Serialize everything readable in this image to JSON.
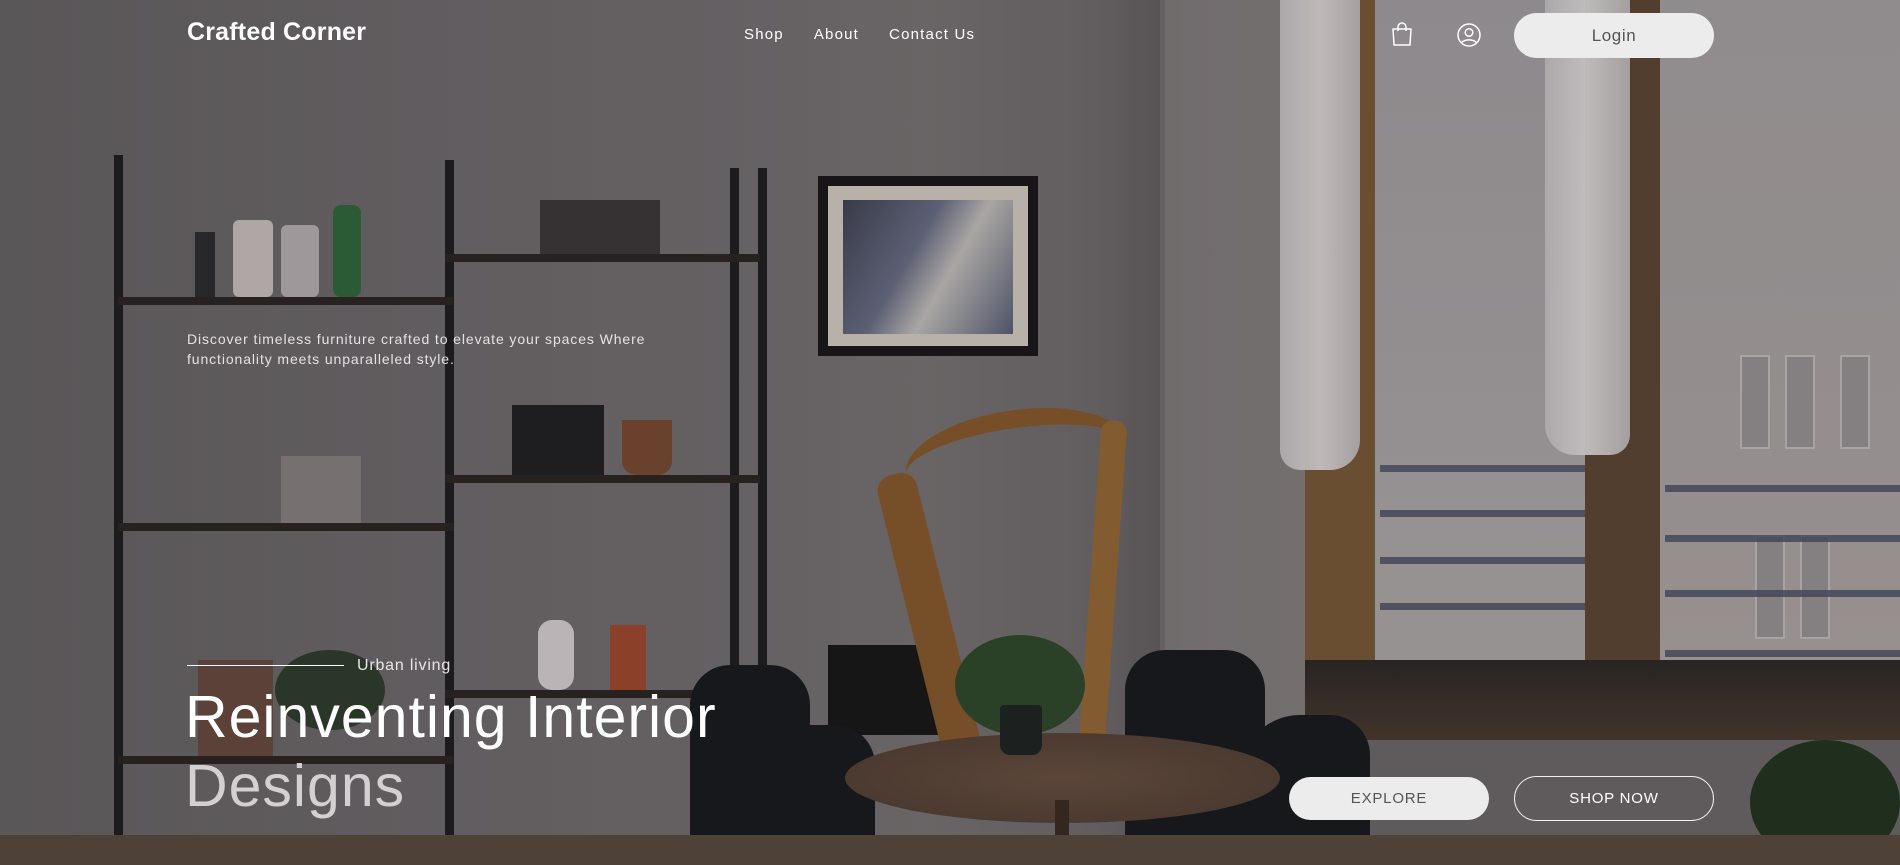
{
  "brand": {
    "name": "Crafted Corner"
  },
  "nav": {
    "items": [
      {
        "label": "Shop"
      },
      {
        "label": "About"
      },
      {
        "label": "Contact Us"
      }
    ]
  },
  "header": {
    "icons": [
      "shopping-bag-icon",
      "user-account-icon"
    ],
    "login_label": "Login"
  },
  "hero": {
    "tagline": "Discover timeless furniture crafted to elevate your spaces Where functionality meets unparalleled style.",
    "eyebrow": "Urban living",
    "title_line1": "Reinventing Interior",
    "title_line2": "Designs",
    "explore_label": "EXPLORE",
    "shop_now_label": "SHOP NOW"
  },
  "colors": {
    "button_fill": "#ececec",
    "button_text": "#555555",
    "text": "#ffffff"
  }
}
